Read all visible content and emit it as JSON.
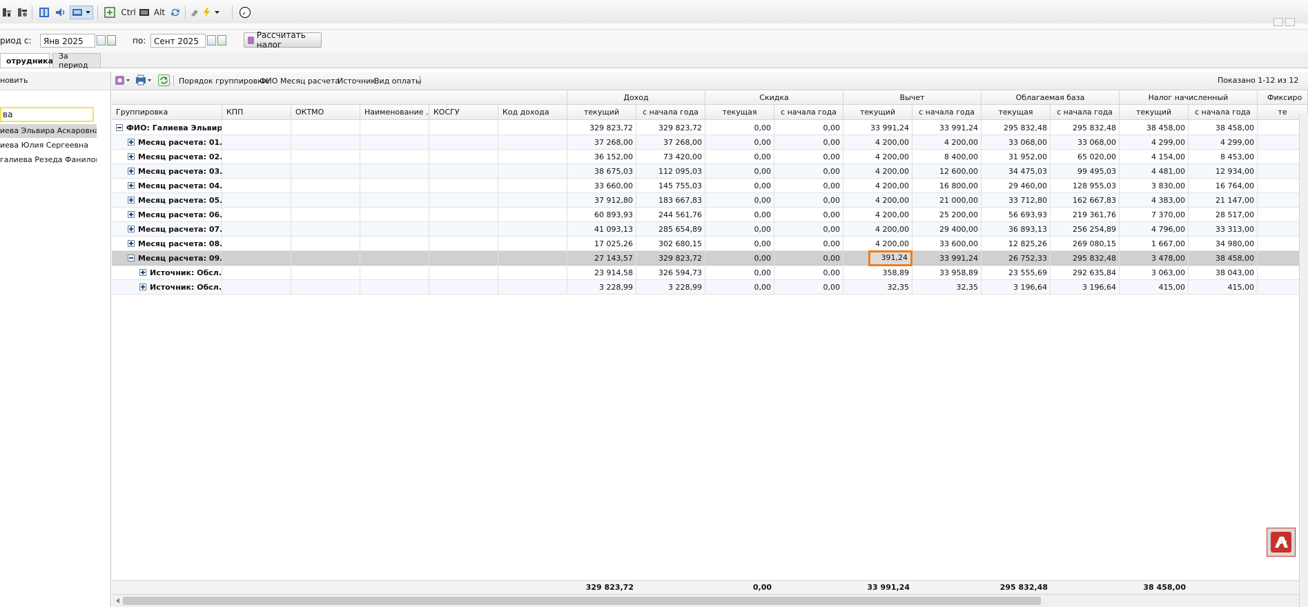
{
  "toolbar": {
    "ctrl_label": "Ctrl",
    "alt_label": "Alt"
  },
  "period": {
    "from_label": "риод с:",
    "from_value": "Янв 2025",
    "to_label": "по:",
    "to_value": "Сент 2025",
    "calc_button": "Рассчитать налог"
  },
  "tabs": [
    {
      "label": "отрудникам"
    },
    {
      "label": "За период"
    }
  ],
  "left": {
    "refresh_label": "новить",
    "search_value": "ва",
    "employees": [
      "иева Эльвира Аскаровна",
      "иева Юлия Сергеевна",
      "галиева Резеда Фаниловна"
    ]
  },
  "grid_toolbar": {
    "grouping_label": "Порядок группировки:",
    "grouping_items": [
      "ФИО",
      "Месяц расчета",
      "Источник",
      "Вид оплаты"
    ],
    "shown_label": "Показано 1-12 из 12"
  },
  "columns": {
    "groups": [
      "Доход",
      "Скидка",
      "Вычет",
      "Облагаемая база",
      "Налог начисленный",
      "Фиксиро"
    ],
    "grouping": "Группировка",
    "kpp": "КПП",
    "oktmo": "ОКТМО",
    "name": "Наименование ...",
    "kosgu": "КОСГУ",
    "income_code": "Код дохода",
    "sub": [
      "текущий",
      "с начала года",
      "текущая",
      "с начала года",
      "текущий",
      "с начала года",
      "текущая",
      "с начала года",
      "текущий",
      "с начала года",
      "те"
    ]
  },
  "rows": [
    {
      "label": "ФИО: Галиева Эльвир...",
      "level": 0,
      "expanded": true,
      "vals": [
        "329 823,72",
        "329 823,72",
        "0,00",
        "0,00",
        "33 991,24",
        "33 991,24",
        "295 832,48",
        "295 832,48",
        "38 458,00",
        "38 458,00"
      ]
    },
    {
      "label": "Месяц расчета: 01...",
      "level": 1,
      "expanded": false,
      "vals": [
        "37 268,00",
        "37 268,00",
        "0,00",
        "0,00",
        "4 200,00",
        "4 200,00",
        "33 068,00",
        "33 068,00",
        "4 299,00",
        "4 299,00"
      ]
    },
    {
      "label": "Месяц расчета: 02...",
      "level": 1,
      "expanded": false,
      "vals": [
        "36 152,00",
        "73 420,00",
        "0,00",
        "0,00",
        "4 200,00",
        "8 400,00",
        "31 952,00",
        "65 020,00",
        "4 154,00",
        "8 453,00"
      ]
    },
    {
      "label": "Месяц расчета: 03...",
      "level": 1,
      "expanded": false,
      "vals": [
        "38 675,03",
        "112 095,03",
        "0,00",
        "0,00",
        "4 200,00",
        "12 600,00",
        "34 475,03",
        "99 495,03",
        "4 481,00",
        "12 934,00"
      ]
    },
    {
      "label": "Месяц расчета: 04...",
      "level": 1,
      "expanded": false,
      "vals": [
        "33 660,00",
        "145 755,03",
        "0,00",
        "0,00",
        "4 200,00",
        "16 800,00",
        "29 460,00",
        "128 955,03",
        "3 830,00",
        "16 764,00"
      ]
    },
    {
      "label": "Месяц расчета: 05...",
      "level": 1,
      "expanded": false,
      "vals": [
        "37 912,80",
        "183 667,83",
        "0,00",
        "0,00",
        "4 200,00",
        "21 000,00",
        "33 712,80",
        "162 667,83",
        "4 383,00",
        "21 147,00"
      ]
    },
    {
      "label": "Месяц расчета: 06...",
      "level": 1,
      "expanded": false,
      "vals": [
        "60 893,93",
        "244 561,76",
        "0,00",
        "0,00",
        "4 200,00",
        "25 200,00",
        "56 693,93",
        "219 361,76",
        "7 370,00",
        "28 517,00"
      ]
    },
    {
      "label": "Месяц расчета: 07...",
      "level": 1,
      "expanded": false,
      "vals": [
        "41 093,13",
        "285 654,89",
        "0,00",
        "0,00",
        "4 200,00",
        "29 400,00",
        "36 893,13",
        "256 254,89",
        "4 796,00",
        "33 313,00"
      ]
    },
    {
      "label": "Месяц расчета: 08...",
      "level": 1,
      "expanded": false,
      "vals": [
        "17 025,26",
        "302 680,15",
        "0,00",
        "0,00",
        "4 200,00",
        "33 600,00",
        "12 825,26",
        "269 080,15",
        "1 667,00",
        "34 980,00"
      ]
    },
    {
      "label": "Месяц расчета: 09...",
      "level": 1,
      "expanded": true,
      "selected": true,
      "vals": [
        "27 143,57",
        "329 823,72",
        "0,00",
        "0,00",
        "391,24",
        "33 991,24",
        "26 752,33",
        "295 832,48",
        "3 478,00",
        "38 458,00"
      ]
    },
    {
      "label": "Источник: Обсл...",
      "level": 2,
      "expanded": false,
      "vals": [
        "23 914,58",
        "326 594,73",
        "0,00",
        "0,00",
        "358,89",
        "33 958,89",
        "23 555,69",
        "292 635,84",
        "3 063,00",
        "38 043,00"
      ]
    },
    {
      "label": "Источник: Обсл...",
      "level": 2,
      "expanded": false,
      "vals": [
        "3 228,99",
        "3 228,99",
        "0,00",
        "0,00",
        "32,35",
        "32,35",
        "3 196,64",
        "3 196,64",
        "415,00",
        "415,00"
      ]
    }
  ],
  "totals": {
    "income": "329 823,72",
    "discount": "0,00",
    "deduction": "33 991,24",
    "base": "295 832,48",
    "tax": "38 458,00"
  },
  "colors": {
    "highlight_border": "#f07d1a",
    "selected_row": "#d0d0d0"
  }
}
